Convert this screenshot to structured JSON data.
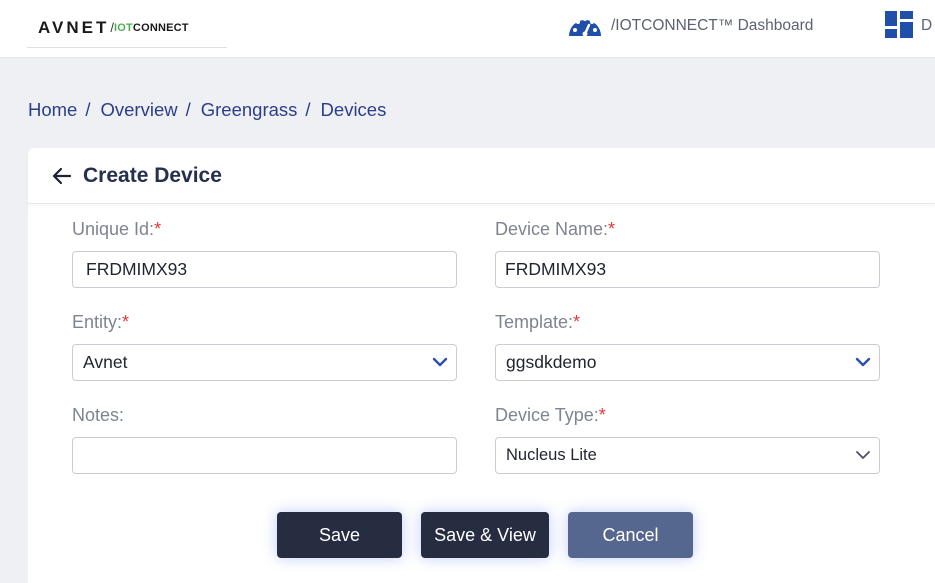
{
  "header": {
    "logo": {
      "brand": "AVNET",
      "slash": "/",
      "iot": "IOT",
      "connect": "CONNECT"
    },
    "nav": [
      {
        "label": "/IOTCONNECT™ Dashboard",
        "icon": "dashboard-gauge-icon"
      },
      {
        "label": "D",
        "icon": "grid-layout-icon"
      }
    ]
  },
  "breadcrumb": [
    "Home",
    "Overview",
    "Greengrass",
    "Devices"
  ],
  "breadcrumb_sep": "/",
  "page": {
    "title": "Create Device"
  },
  "form": {
    "unique_id": {
      "label": "Unique Id:",
      "value": "FRDMIMX93",
      "required": "*"
    },
    "device_name": {
      "label": "Device Name:",
      "value": "FRDMIMX93",
      "required": "*"
    },
    "entity": {
      "label": "Entity:",
      "value": "Avnet",
      "required": "*"
    },
    "template": {
      "label": "Template:",
      "value": "ggsdkdemo",
      "required": "*"
    },
    "notes": {
      "label": "Notes:",
      "value": ""
    },
    "device_type": {
      "label": "Device Type:",
      "value": "Nucleus Lite",
      "required": "*"
    }
  },
  "actions": {
    "save": "Save",
    "save_view": "Save & View",
    "cancel": "Cancel"
  },
  "colors": {
    "accent": "#2b3e8c",
    "icon_blue": "#1f4fa8",
    "required": "#e03a3a",
    "button_dark": "#262d40",
    "button_cancel": "#56678f"
  }
}
